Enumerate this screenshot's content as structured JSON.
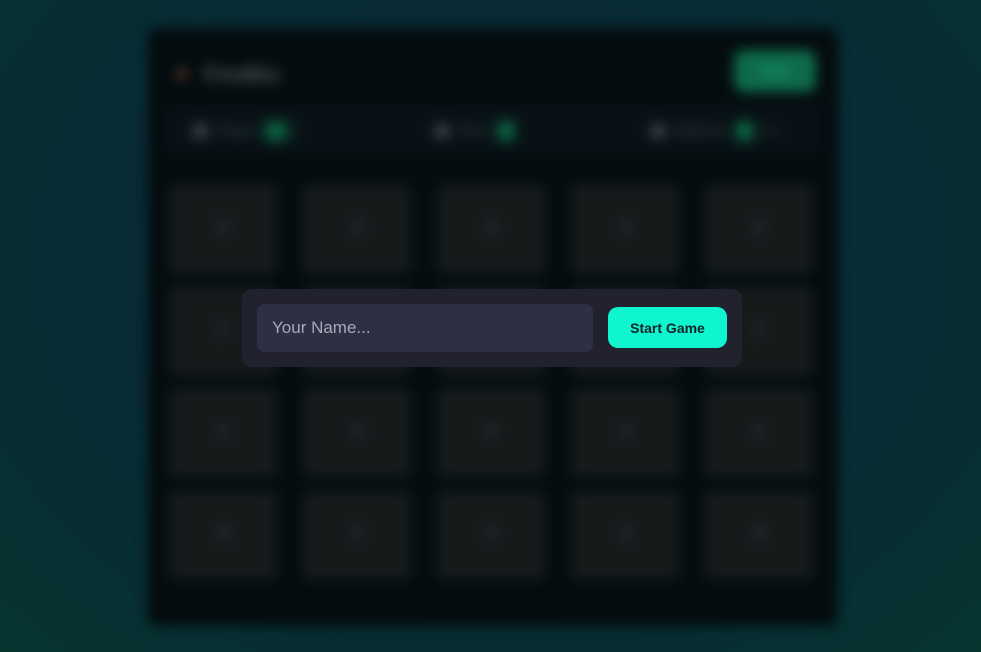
{
  "header": {
    "logo_icon": "flame-icon",
    "title": "FireBlo",
    "button_label": "Start"
  },
  "stats": [
    {
      "icon": "user-icon",
      "label": "Player",
      "value": "—",
      "extra": "0"
    },
    {
      "icon": "clock-icon",
      "label": "Time",
      "value": "0",
      "extra": ""
    },
    {
      "icon": "trophy-icon",
      "label": "Matches",
      "value": "0",
      "extra": "/10"
    }
  ],
  "tiles": [
    "?",
    "?",
    "?",
    "?",
    "?",
    "?",
    "?",
    "?",
    "?",
    "?",
    "?",
    "?",
    "?",
    "?",
    "?",
    "?",
    "?",
    "?",
    "?",
    "?"
  ],
  "modal": {
    "name_input": {
      "placeholder": "Your Name...",
      "value": ""
    },
    "start_button_label": "Start Game"
  },
  "colors": {
    "accent": "#0ff5cf",
    "modal_bg": "#22222f",
    "input_bg": "#2e2e44",
    "board_bg": "#040c0f"
  }
}
